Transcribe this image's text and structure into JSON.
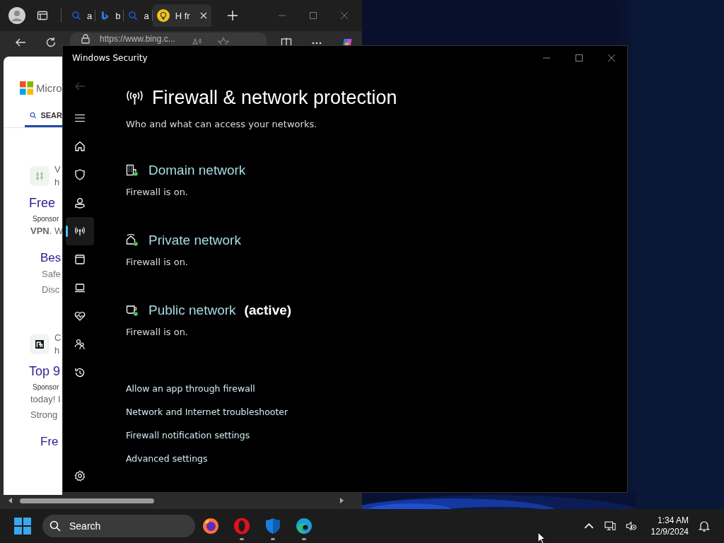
{
  "browser": {
    "tabs": [
      {
        "label": "a",
        "kind": "search",
        "selected": false
      },
      {
        "label": "b",
        "kind": "bing",
        "selected": false
      },
      {
        "label": "a",
        "kind": "search",
        "selected": false
      },
      {
        "label": "H fr",
        "kind": "bulb",
        "selected": true
      }
    ],
    "url": "https://www.bing.c...",
    "page": [
      {
        "kind": "logo",
        "text": "Micro"
      },
      {
        "kind": "nav_tab",
        "text": "SEAR",
        "selected": true
      },
      {
        "kind": "source",
        "lines": [
          "V",
          "h"
        ]
      },
      {
        "kind": "headline",
        "text": "Free"
      },
      {
        "kind": "meta",
        "text": "Sponsor"
      },
      {
        "kind": "snippet",
        "text": "**VPN**. W"
      },
      {
        "kind": "sublink",
        "text": "Bes"
      },
      {
        "kind": "sub_snippet",
        "text": "Safe"
      },
      {
        "kind": "sub_snippet",
        "text": "Disc"
      },
      {
        "kind": "source",
        "lines": [
          "C",
          "h"
        ]
      },
      {
        "kind": "headline",
        "text": "Top 9"
      },
      {
        "kind": "meta",
        "text": "Sponsor"
      },
      {
        "kind": "snippet",
        "text": "today! I"
      },
      {
        "kind": "snippet",
        "text": "Strong"
      },
      {
        "kind": "sublink",
        "text": "Fre"
      }
    ]
  },
  "security": {
    "title": "Windows Security",
    "back_disabled": true,
    "nav": [
      {
        "kind": "menu",
        "selected": false
      },
      {
        "kind": "home",
        "selected": false
      },
      {
        "kind": "shield",
        "selected": false
      },
      {
        "kind": "person",
        "selected": false
      },
      {
        "kind": "antenna",
        "selected": true
      },
      {
        "kind": "browser",
        "selected": false
      },
      {
        "kind": "laptop",
        "selected": false
      },
      {
        "kind": "heart",
        "selected": false
      },
      {
        "kind": "family",
        "selected": false
      },
      {
        "kind": "history",
        "selected": false
      }
    ],
    "heading": "Firewall & network protection",
    "subtitle": "Who and what can access your networks.",
    "networks": [
      {
        "kind": "domain",
        "name": "Domain network",
        "status": "Firewall is on."
      },
      {
        "kind": "private",
        "name": "Private network",
        "status": "Firewall is on."
      },
      {
        "kind": "public",
        "name": "Public network",
        "badge": "(active)",
        "status": "Firewall is on."
      }
    ],
    "links": [
      "Allow an app through firewall",
      "Network and Internet troubleshooter",
      "Firewall notification settings",
      "Advanced settings"
    ]
  },
  "taskbar": {
    "search_label": "Search",
    "apps": [
      {
        "kind": "firefox",
        "running": false
      },
      {
        "kind": "opera",
        "running": true
      },
      {
        "kind": "defender",
        "running": true
      },
      {
        "kind": "edge",
        "running": true
      }
    ],
    "time": "1:34 AM",
    "date": "12/9/2024"
  }
}
